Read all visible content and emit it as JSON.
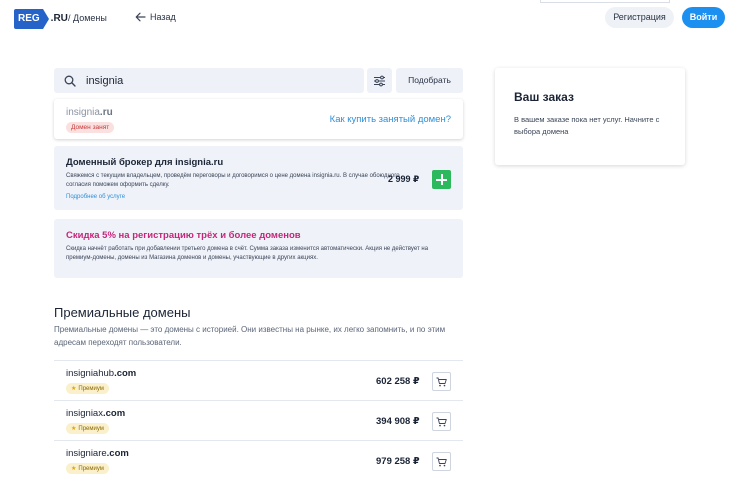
{
  "header": {
    "logo_reg": "REG",
    "logo_ru": ".RU",
    "breadcrumb": "/ Домены",
    "back_label": "Назад",
    "register_label": "Регистрация",
    "login_label": "Войти"
  },
  "search": {
    "value": "insignia",
    "pick_label": "Подобрать"
  },
  "taken": {
    "domain_name": "insignia",
    "domain_zone": ".ru",
    "badge": "Домен занят",
    "how_buy_link": "Как купить занятый домен?"
  },
  "broker": {
    "title": "Доменный брокер для insignia.ru",
    "text": "Свяжемся с текущим владельцем, проведём переговоры и договоримся о цене домена insignia.ru. В случае обоюдного согласия поможем оформить сделку.",
    "link": "Подробнее об услуге",
    "price": "2 999 ₽"
  },
  "discount": {
    "title": "Скидка 5% на регистрацию трёх и более доменов",
    "text": "Скидка начнёт работать при добавлении третьего домена в счёт. Сумма заказа изменится автоматически. Акция не действует на премиум-домены, домены из Магазина доменов и домены, участвующие в других акциях."
  },
  "premium": {
    "title": "Премиальные домены",
    "description": "Премиальные домены — это домены с историей. Они известны на рынке, их легко запомнить, и по этим адресам переходят пользователи.",
    "items": [
      {
        "name": "insigniahub",
        "zone": ".com",
        "badge": "Премиум",
        "price": "602 258 ₽"
      },
      {
        "name": "insigniax",
        "zone": ".com",
        "badge": "Премиум",
        "price": "394 908 ₽"
      },
      {
        "name": "insigniare",
        "zone": ".com",
        "badge": "Премиум",
        "price": "979 258 ₽"
      }
    ]
  },
  "order": {
    "title": "Ваш заказ",
    "text": "В вашем заказе пока нет услуг. Начните с выбора домена"
  },
  "colors": {
    "brand_blue": "#2563c9",
    "login_blue": "#1b90f0",
    "link_blue": "#2f8fd8",
    "add_green": "#2cb85c",
    "discount_pink": "#c4277a",
    "taken_red": "#c23b3b"
  },
  "icons": [
    "search-icon",
    "filter-icon",
    "arrow-left-icon",
    "plus-icon",
    "cart-icon",
    "star-icon"
  ]
}
